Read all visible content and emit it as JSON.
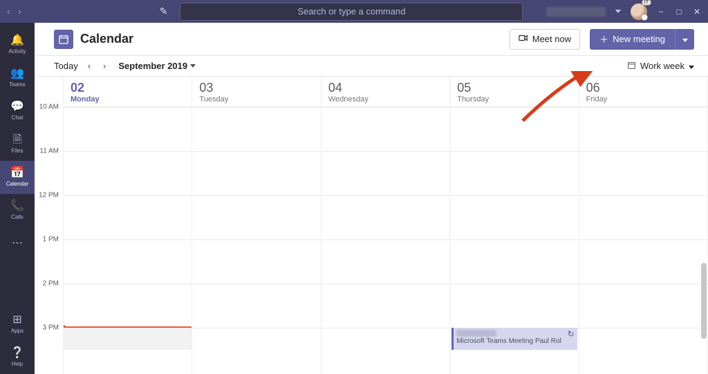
{
  "titlebar": {
    "search_placeholder": "Search or type a command"
  },
  "rail": {
    "activity": "Activity",
    "teams": "Teams",
    "chat": "Chat",
    "files": "Files",
    "calendar": "Calendar",
    "calls": "Calls",
    "apps": "Apps",
    "help": "Help"
  },
  "header": {
    "title": "Calendar",
    "meet_now": "Meet now",
    "new_meeting": "New meeting"
  },
  "subhead": {
    "today": "Today",
    "month": "September 2019",
    "view_label": "Work week"
  },
  "days": [
    {
      "num": "02",
      "name": "Monday",
      "current": true
    },
    {
      "num": "03",
      "name": "Tuesday",
      "current": false
    },
    {
      "num": "04",
      "name": "Wednesday",
      "current": false
    },
    {
      "num": "05",
      "name": "Thursday",
      "current": false
    },
    {
      "num": "06",
      "name": "Friday",
      "current": false
    }
  ],
  "times": [
    "10 AM",
    "11 AM",
    "12 PM",
    "1 PM",
    "2 PM",
    "3 PM"
  ],
  "event": {
    "location_prefix": "Microsoft Teams Meeting",
    "organizer": "Paul Rol"
  },
  "avatar_badge": "IT"
}
